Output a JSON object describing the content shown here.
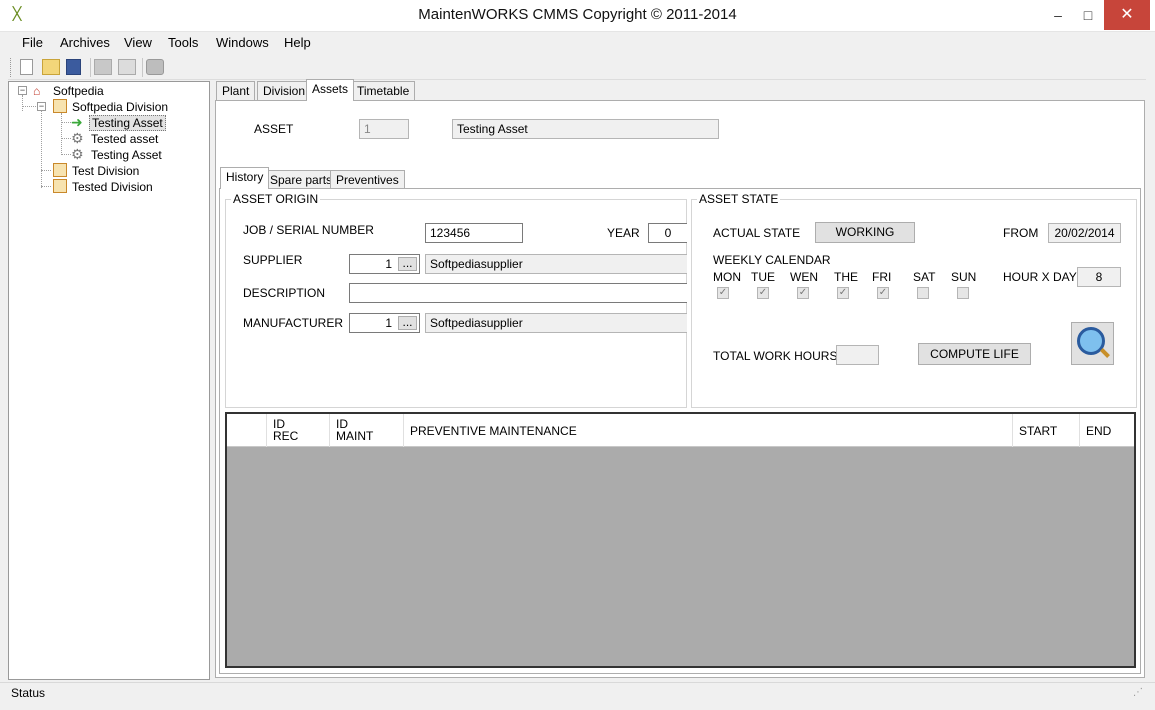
{
  "window": {
    "title": "MaintenWORKS CMMS Copyright © 2011-2014",
    "minimize": "–",
    "maximize": "□",
    "close": "✕"
  },
  "menu": [
    "File",
    "Archives",
    "View",
    "Tools",
    "Windows",
    "Help"
  ],
  "tree": {
    "root": "Softpedia",
    "division1": "Softpedia Division",
    "asset1": "Testing Asset",
    "asset2": "Tested asset",
    "asset3": "Testing Asset",
    "division2": "Test Division",
    "division3": "Tested Division"
  },
  "main_tabs": [
    "Plant",
    "Division",
    "Assets",
    "Timetable"
  ],
  "asset": {
    "label": "ASSET",
    "id": "1",
    "name": "Testing Asset"
  },
  "sub_tabs": [
    "History",
    "Spare parts",
    "Preventives"
  ],
  "origin": {
    "title": "ASSET ORIGIN",
    "serial_label": "JOB / SERIAL NUMBER",
    "serial_value": "123456",
    "year_label": "YEAR",
    "year_value": "0",
    "supplier_label": "SUPPLIER",
    "supplier_id": "1",
    "supplier_name": "Softpediasupplier",
    "description_label": "DESCRIPTION",
    "description_value": "",
    "manufacturer_label": "MANUFACTURER",
    "manufacturer_id": "1",
    "manufacturer_name": "Softpediasupplier",
    "browse": "..."
  },
  "state": {
    "title": "ASSET STATE",
    "actual_label": "ACTUAL STATE",
    "actual_value": "WORKING",
    "from_label": "FROM",
    "from_value": "20/02/2014",
    "calendar_label": "WEEKLY CALENDAR",
    "days": [
      "MON",
      "TUE",
      "WEN",
      "THE",
      "FRI",
      "SAT",
      "SUN"
    ],
    "days_checked": [
      true,
      true,
      true,
      true,
      true,
      false,
      false
    ],
    "hours_label": "HOUR X DAY",
    "hours_value": "8",
    "total_label": "TOTAL WORK HOURS",
    "total_value": "",
    "compute_label": "COMPUTE LIFE"
  },
  "grid": {
    "columns": [
      "",
      "ID\nREC",
      "ID\nMAINT",
      "PREVENTIVE MAINTENANCE",
      "START",
      "END"
    ]
  },
  "status": {
    "text": "Status"
  }
}
